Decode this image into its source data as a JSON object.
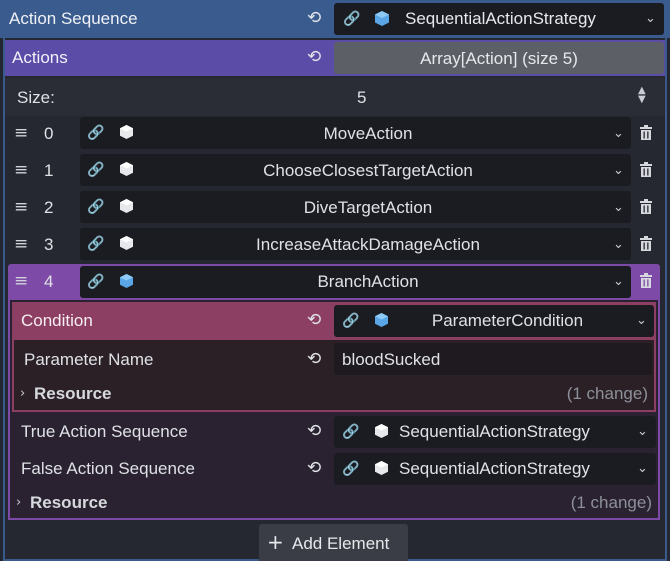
{
  "header": {
    "title": "Action Sequence",
    "strategy_label": "SequentialActionStrategy",
    "accent": "#3b5a8c"
  },
  "actions": {
    "title": "Actions",
    "array_label": "Array[Action] (size 5)",
    "size_label": "Size:",
    "size_value": "5",
    "accent": "#5a4aa6",
    "items": [
      {
        "index": "0",
        "label": "MoveAction"
      },
      {
        "index": "1",
        "label": "ChooseClosestTargetAction"
      },
      {
        "index": "2",
        "label": "DiveTargetAction"
      },
      {
        "index": "3",
        "label": "IncreaseAttackDamageAction"
      },
      {
        "index": "4",
        "label": "BranchAction"
      }
    ]
  },
  "branch": {
    "accent": "#7e4aa6",
    "condition": {
      "title": "Condition",
      "value": "ParameterCondition",
      "accent": "#8c3f62",
      "param_name_label": "Parameter Name",
      "param_name_value": "bloodSucked",
      "resource_label": "Resource",
      "resource_changes": "(1 change)"
    },
    "true_label": "True Action Sequence",
    "true_value": "SequentialActionStrategy",
    "false_label": "False Action Sequence",
    "false_value": "SequentialActionStrategy",
    "resource_label": "Resource",
    "resource_changes": "(1 change)"
  },
  "add_button": "Add Element",
  "icons": {
    "revert": "revert-icon",
    "link": "link-icon",
    "cube": "cube-icon",
    "chevron": "chevron-down-icon",
    "handle": "drag-handle-icon",
    "trash": "trash-icon"
  }
}
